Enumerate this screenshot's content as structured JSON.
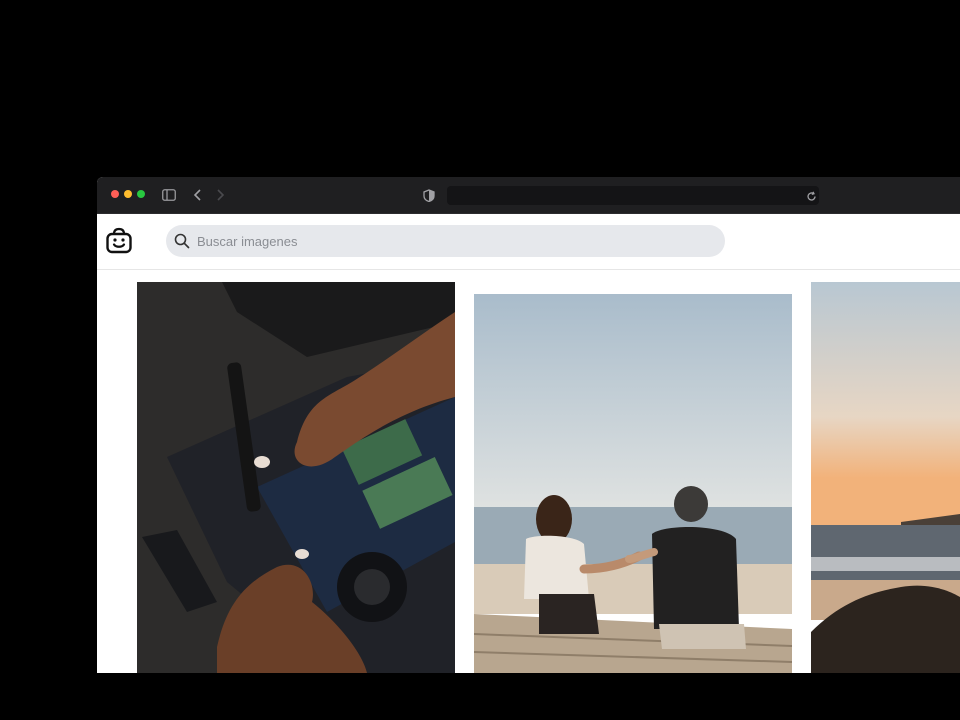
{
  "browser": {
    "traffic_lights": [
      "close",
      "minimize",
      "zoom"
    ],
    "icons": [
      "sidebar-icon",
      "back-icon",
      "forward-icon",
      "shield-icon",
      "reload-icon"
    ]
  },
  "app": {
    "logo_icon": "smiley-bag-icon",
    "search": {
      "placeholder": "Buscar imagenes"
    }
  },
  "gallery": {
    "items": [
      {
        "subject": "laptop-repair-photo"
      },
      {
        "subject": "beach-couple-photo"
      },
      {
        "subject": "sunset-coast-photo"
      }
    ]
  },
  "colors": {
    "titlebar": "#1f1f21",
    "search_bg": "#e6e8ec",
    "traffic_red": "#fe5f57",
    "traffic_yellow": "#febc2e",
    "traffic_green": "#28c840"
  }
}
